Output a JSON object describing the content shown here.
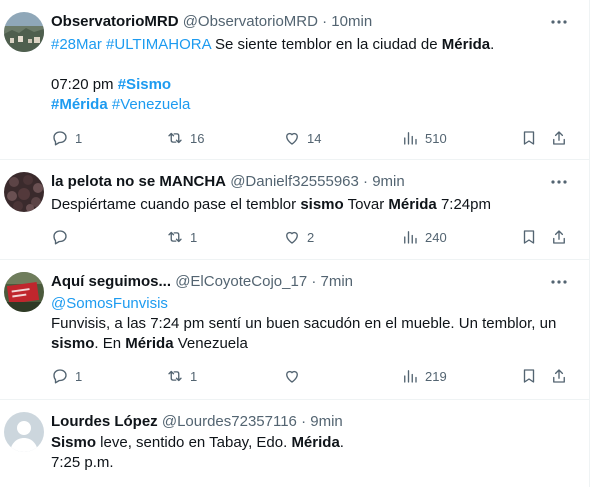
{
  "tweets": [
    {
      "name": "ObservatorioMRD",
      "handle": "@ObservatorioMRD",
      "time": "· 10min",
      "avatar_color": "#6a7f8c",
      "tag1": "#28Mar",
      "tag2": "#ULTIMAHORA",
      "text1": " Se siente temblor en la ciudad de ",
      "bold1": "Mérida",
      "text2": ".",
      "time_line": "07:20 pm ",
      "tag_sismo": "#Sismo",
      "tag_merida": "#Mérida",
      "tag_venezuela": "#Venezuela",
      "replies": "1",
      "retweets": "16",
      "likes": "14",
      "views": "510"
    },
    {
      "name": "la pelota no se MANCHA",
      "handle": "@Danielf32555963",
      "time": "· 9min",
      "avatar_color": "#3a2a2c",
      "text1": "Despiértame cuando pase el temblor ",
      "bold1": "sismo",
      "text2": " Tovar ",
      "bold2": "Mérida",
      "text3": " 7:24pm",
      "replies": "",
      "retweets": "1",
      "likes": "2",
      "views": "240"
    },
    {
      "name": "Aquí seguimos...",
      "handle": "@ElCoyoteCojo_17",
      "time": "· 7min",
      "avatar_color": "#c0262d",
      "mention": "@SomosFunvisis",
      "text1": "Funvisis, a las 7:24 pm sentí un buen sacudón en el mueble. Un temblor, un ",
      "bold1": "sismo",
      "text2": ". En ",
      "bold2": "Mérida",
      "text3": " Venezuela",
      "replies": "1",
      "retweets": "1",
      "likes": "",
      "views": "219"
    },
    {
      "name": "Lourdes López",
      "handle": "@Lourdes72357116",
      "time": "· 9min",
      "avatar_color": "#ccd6dd",
      "bold1": "Sismo",
      "text1": " leve, sentido en Tabay, Edo. ",
      "bold2": "Mérida",
      "text2": ".",
      "text3": "7:25 p.m."
    }
  ],
  "icons": {
    "reply": "reply-icon",
    "retweet": "retweet-icon",
    "like": "heart-icon",
    "views": "views-icon",
    "bookmark": "bookmark-icon",
    "share": "share-icon",
    "more": "more-icon"
  },
  "colors": {
    "link": "#1d9bf0",
    "muted": "#536471",
    "text": "#0f1419",
    "divider": "#eff3f4"
  }
}
